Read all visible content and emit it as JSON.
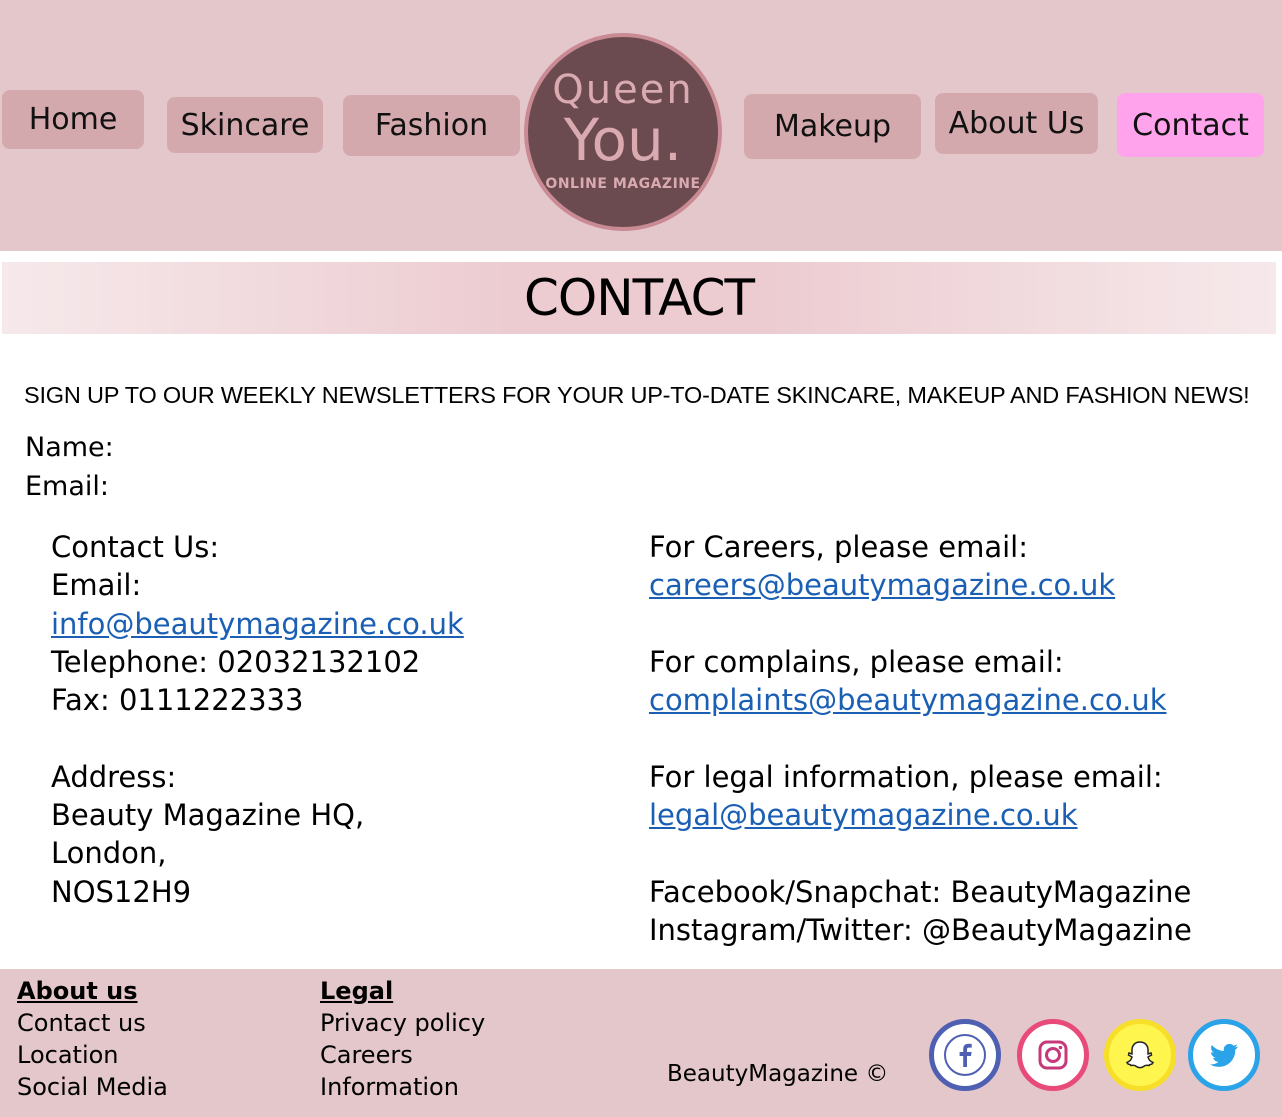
{
  "nav": {
    "home": "Home",
    "skincare": "Skincare",
    "fashion": "Fashion",
    "makeup": "Makeup",
    "about": "About Us",
    "contact": "Contact",
    "active": "Contact",
    "active_color": "#fea3ec"
  },
  "logo": {
    "line1": "Queen",
    "line2": "You.",
    "line3": "ONLINE MAGAZINE"
  },
  "page_title": "CONTACT",
  "newsletter": {
    "text": "SIGN UP TO OUR  WEEKLY NEWSLETTERS FOR YOUR UP-TO-DATE SKINCARE, MAKEUP AND FASHION NEWS!",
    "name_label": "Name:",
    "email_label": "Email:"
  },
  "contact_left": {
    "heading": "Contact Us:",
    "email_label": "Email:",
    "email": "info@beautymagazine.co.uk",
    "telephone": "Telephone: 02032132102",
    "fax": "Fax: 0111222333",
    "address_label": "Address:",
    "address_line1": "Beauty Magazine HQ,",
    "address_line2": "London,",
    "address_line3": "NOS12H9"
  },
  "contact_right": {
    "careers_label": "For Careers, please email:",
    "careers_email": "careers@beautymagazine.co.uk",
    "complaints_label": "For complains, please email:",
    "complaints_email": "complaints@beautymagazine.co.uk",
    "legal_label": "For legal information, please email:",
    "legal_email": "legal@beautymagazine.co.uk",
    "facebook_snapchat": "Facebook/Snapchat: BeautyMagazine",
    "instagram_twitter": "Instagram/Twitter: @BeautyMagazine"
  },
  "footer": {
    "about_heading": "About us",
    "about_items": [
      "Contact us",
      "Location",
      "Social Media"
    ],
    "legal_heading": "Legal",
    "legal_items": [
      "Privacy policy",
      "Careers",
      "Information"
    ],
    "copyright": "BeautyMagazine ©"
  },
  "social_icons": [
    "facebook-icon",
    "instagram-icon",
    "snapchat-icon",
    "twitter-icon"
  ],
  "colors": {
    "header_bg": "#e3c7ca",
    "nav_button": "#d4a9ad",
    "link": "#1a5fb4"
  }
}
